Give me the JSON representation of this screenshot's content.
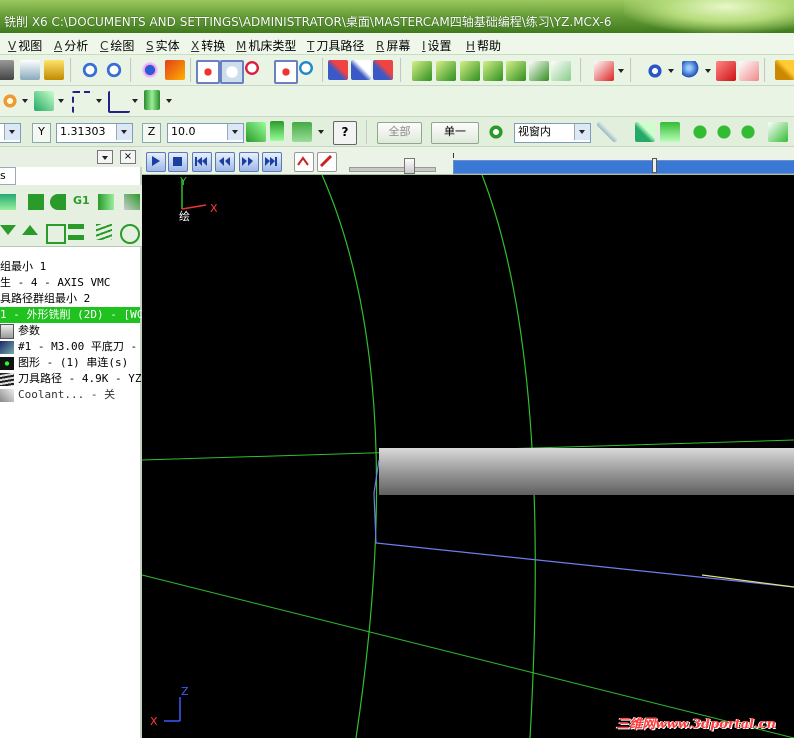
{
  "title": "铣削 X6  C:\\DOCUMENTS AND SETTINGS\\ADMINISTRATOR\\桌面\\MASTERCAM四轴基础编程\\练习\\YZ.MCX-6",
  "menu": [
    {
      "key": "V",
      "label": "视图"
    },
    {
      "key": "A",
      "label": "分析"
    },
    {
      "key": "C",
      "label": "绘图"
    },
    {
      "key": "S",
      "label": "实体"
    },
    {
      "key": "X",
      "label": "转换"
    },
    {
      "key": "M",
      "label": "机床类型"
    },
    {
      "key": "T",
      "label": "刀具路径"
    },
    {
      "key": "R",
      "label": "屏幕"
    },
    {
      "key": "I",
      "label": "设置"
    },
    {
      "key": "H",
      "label": "帮助"
    }
  ],
  "coords": {
    "y_label": "Y",
    "y_value": "1.31303",
    "z_label": "Z",
    "z_value": "10.0",
    "all_button": "全部",
    "single_button": "单一",
    "view_select": "视窗内"
  },
  "left_panel": {
    "tab_label": "s",
    "tree": [
      "组最小 1",
      "生 - 4 - AXIS VMC",
      "具路径群组最小 2",
      "1 - 外形铣削 (2D) - [WC",
      "参数",
      "#1 - M3.00 平底刀 -",
      "图形 - (1) 串连(s)",
      "刀具路径 - 4.9K - YZ",
      "Coolant... - 关"
    ]
  },
  "viewport": {
    "axis_top_y": "Y",
    "axis_top_x": "X",
    "axis_top_text": "绘",
    "axis_bottom_z": "Z",
    "axis_bottom_x": "X",
    "watermark": "三维网www.3dportal.cn"
  },
  "colors": {
    "title_bar": "#5e9630",
    "selection": "#1fc21f",
    "progress": "#3a78d6",
    "geometry_green": "#2fbf2f",
    "toolpath_blue": "#6f7df0",
    "watermark": "#ff3b3b"
  }
}
